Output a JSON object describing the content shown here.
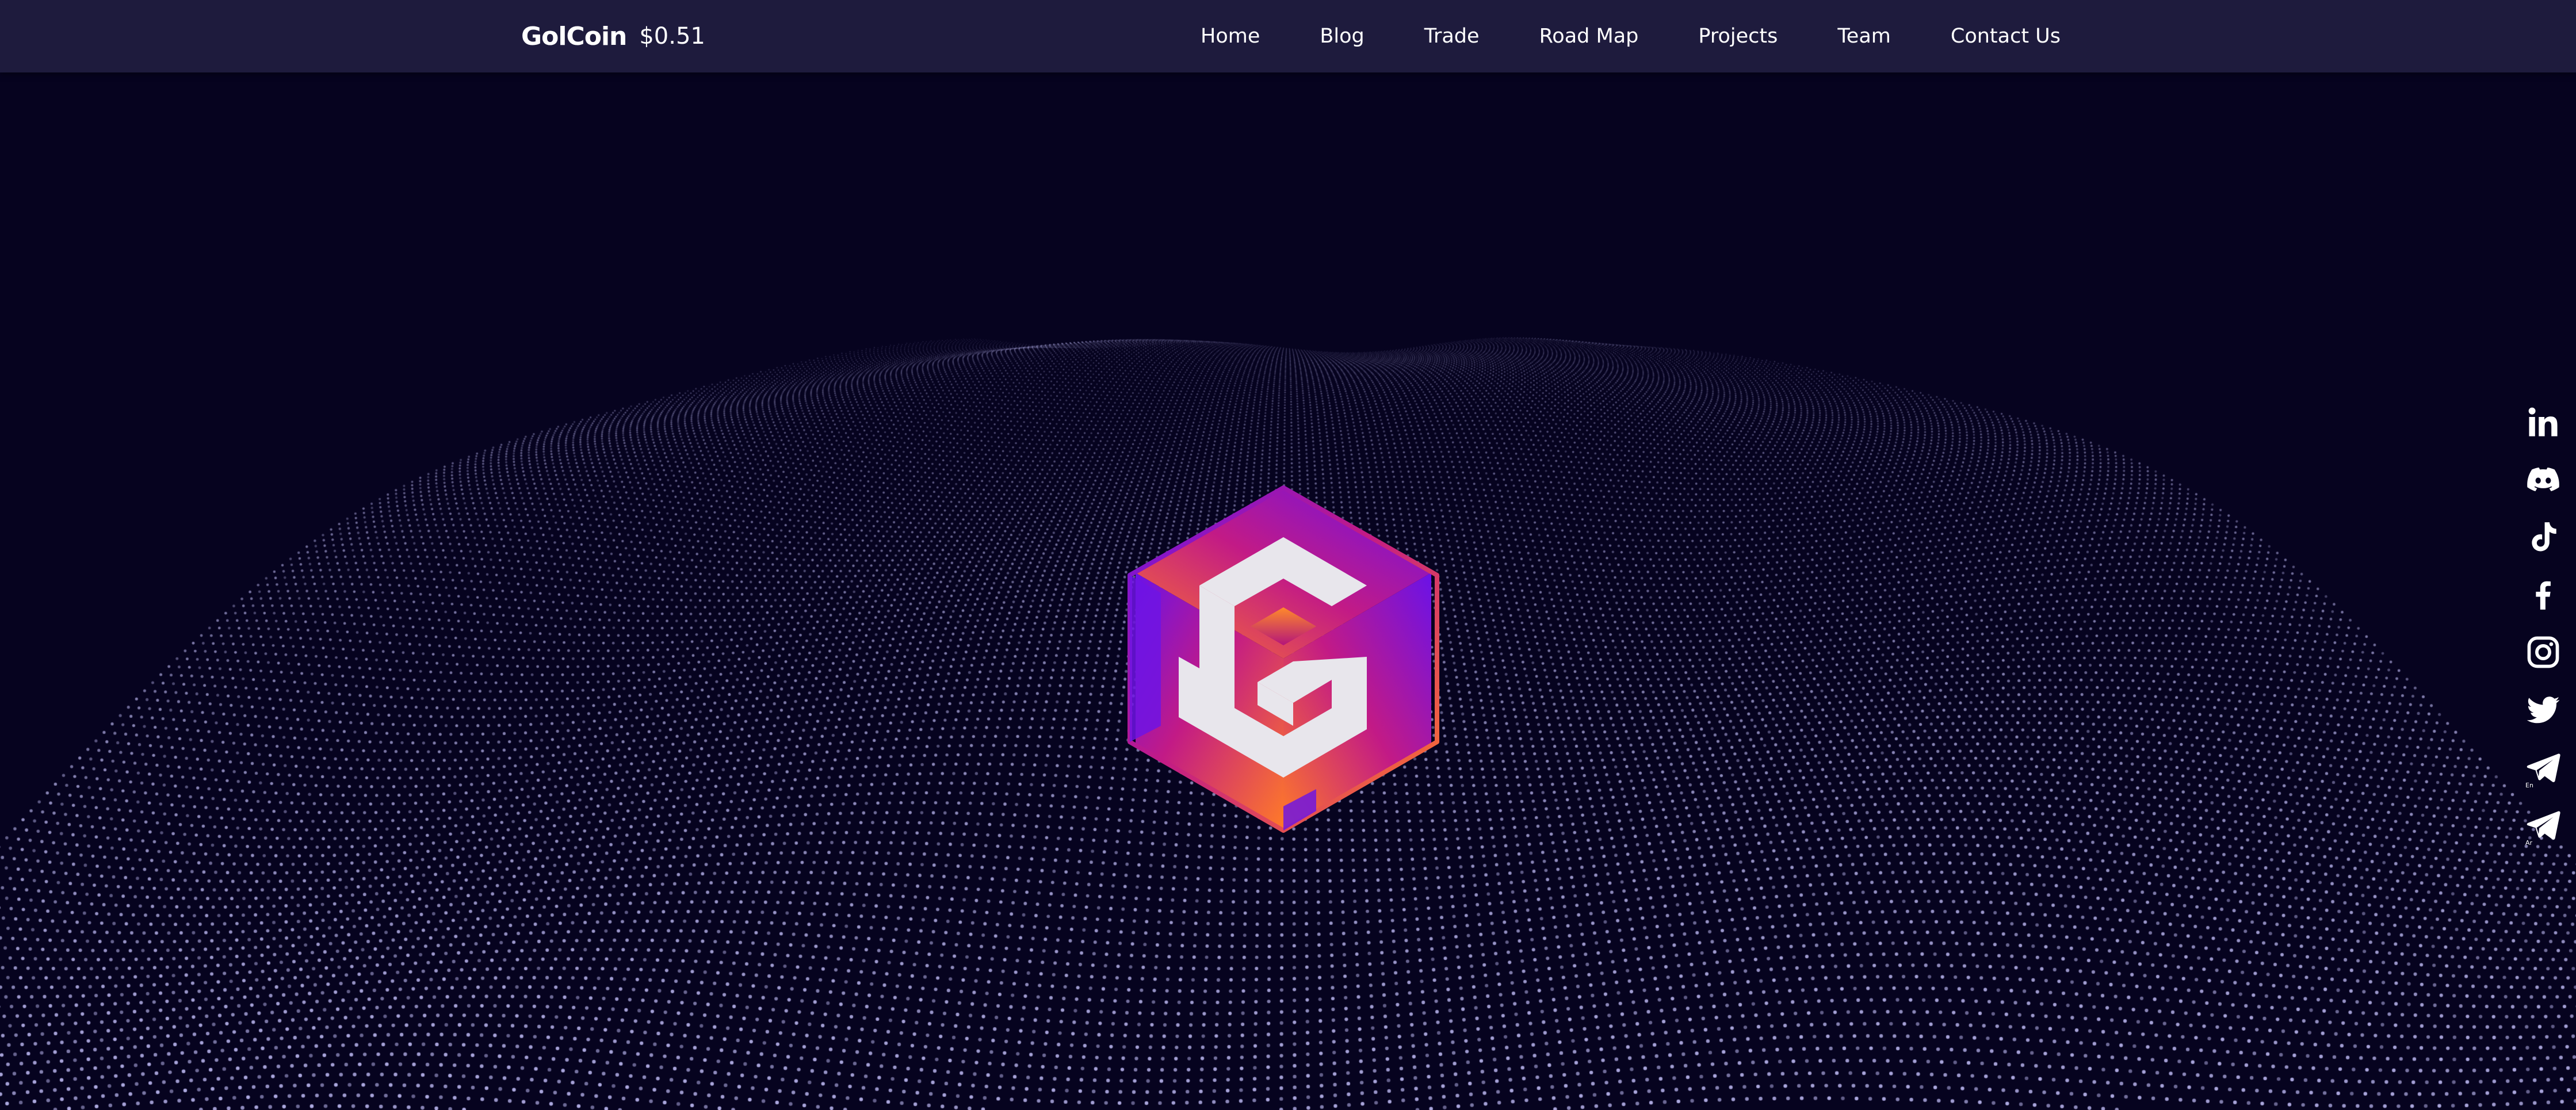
{
  "header": {
    "brand": "GolCoin",
    "price": "$0.51",
    "nav": [
      "Home",
      "Blog",
      "Trade",
      "Road Map",
      "Projects",
      "Team",
      "Contact Us"
    ]
  },
  "social": [
    {
      "icon": "linkedin-icon"
    },
    {
      "icon": "discord-icon"
    },
    {
      "icon": "tiktok-icon"
    },
    {
      "icon": "facebook-icon"
    },
    {
      "icon": "instagram-icon"
    },
    {
      "icon": "twitter-icon"
    },
    {
      "icon": "telegram-icon",
      "tag": "En"
    },
    {
      "icon": "telegram-icon",
      "tag": "Ar"
    }
  ],
  "colors": {
    "background": "#06031f",
    "header": "#1e1b3d",
    "logo_purple": "#6a12e8",
    "logo_magenta": "#c21a86",
    "logo_orange": "#ff7a28",
    "logo_letter": "#e8e6ec"
  }
}
